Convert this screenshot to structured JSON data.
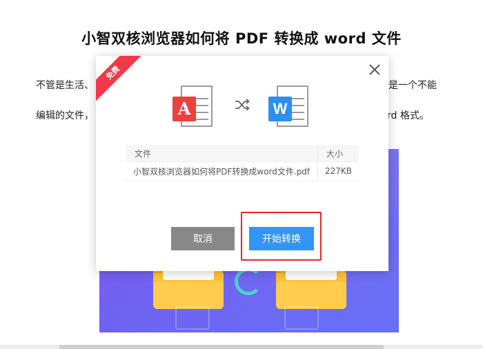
{
  "article": {
    "title": "小智双核浏览器如何将 PDF 转换成 word 文件",
    "line1_left": "不管是生活、",
    "line1_right": "是一个不能",
    "line2_left": "编辑的文件，",
    "line2_right": "rd 格式。"
  },
  "modal": {
    "ribbon": "免费",
    "pdf_badge": "A",
    "word_badge": "W",
    "table": {
      "headers": [
        "文件",
        "大小"
      ],
      "rows": [
        {
          "name": "小智双核浏览器如何将PDF转换成word文件.pdf",
          "size": "227KB"
        }
      ]
    },
    "cancel_label": "取消",
    "start_label": "开始转换"
  },
  "colors": {
    "pdf_red": "#e9423f",
    "word_blue": "#2d8ff0",
    "start_button": "#3395f5",
    "cancel_button": "#888888",
    "ribbon_red": "#f0394a",
    "highlight_red": "#e8232b"
  },
  "icons": {
    "close": "close-icon",
    "shuffle": "shuffle-icon",
    "pdf": "pdf-file-icon",
    "word": "word-file-icon"
  }
}
